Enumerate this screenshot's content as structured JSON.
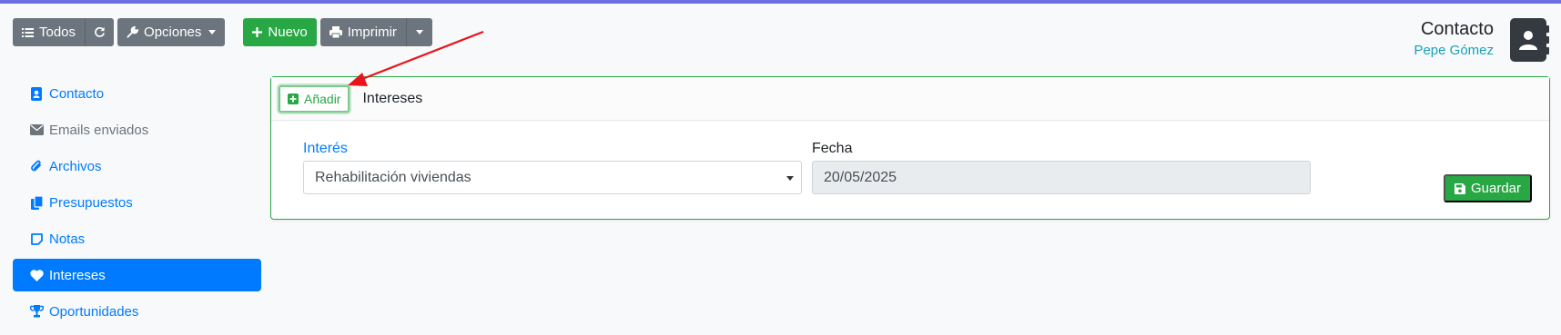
{
  "toolbar": {
    "todos_label": "Todos",
    "opciones_label": "Opciones",
    "nuevo_label": "Nuevo",
    "imprimir_label": "Imprimir"
  },
  "contact": {
    "title": "Contacto",
    "name": "Pepe Gómez"
  },
  "sidebar": {
    "items": [
      {
        "label": "Contacto",
        "icon": "contact-card-icon"
      },
      {
        "label": "Emails enviados",
        "icon": "envelope-icon"
      },
      {
        "label": "Archivos",
        "icon": "paperclip-icon"
      },
      {
        "label": "Presupuestos",
        "icon": "copy-icon"
      },
      {
        "label": "Notas",
        "icon": "sticky-note-icon"
      },
      {
        "label": "Intereses",
        "icon": "heart-icon",
        "active": true
      },
      {
        "label": "Oportunidades",
        "icon": "trophy-icon"
      }
    ]
  },
  "card": {
    "add_label": "Añadir",
    "title": "Intereses",
    "interes_label": "Interés",
    "interes_value": "Rehabilitación viviendas",
    "fecha_label": "Fecha",
    "fecha_value": "20/05/2025",
    "save_label": "Guardar"
  },
  "colors": {
    "primary": "#007bff",
    "success": "#28a745",
    "secondary": "#6c757d",
    "info": "#17a2b8",
    "annotation_arrow": "#e8141b"
  }
}
